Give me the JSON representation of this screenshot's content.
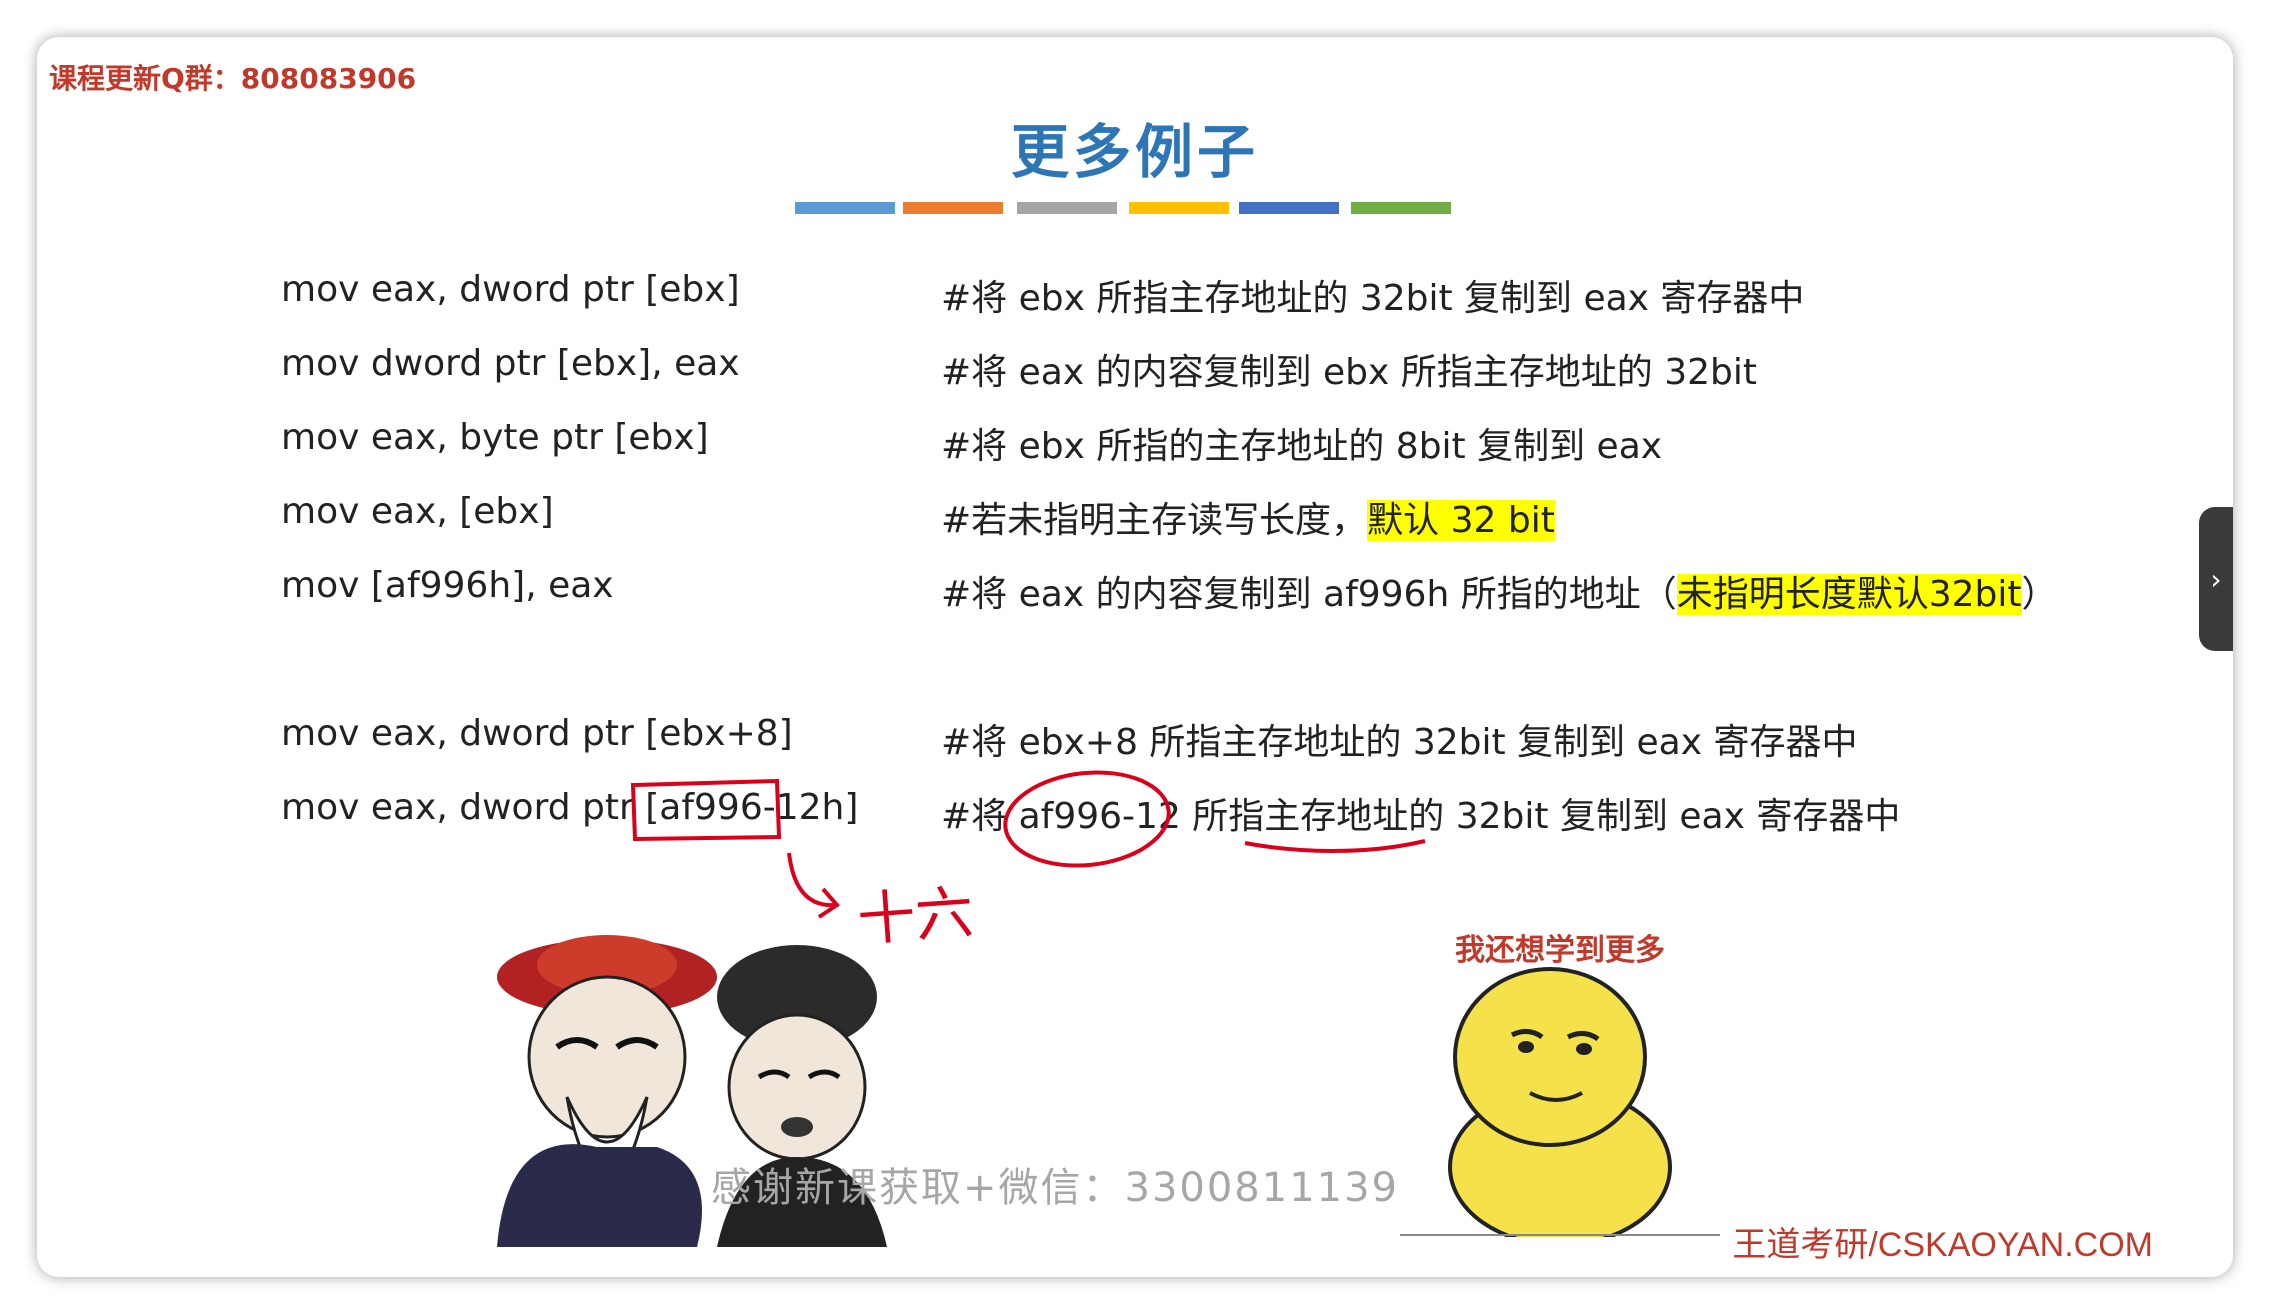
{
  "header": {
    "qq_note": "课程更新Q群：808083906"
  },
  "slide": {
    "title": "更多例子",
    "color_bar": [
      "#5b9bd5",
      "#ed7d31",
      "#a5a5a5",
      "#ffc000",
      "#4472c4",
      "#70ad47"
    ],
    "rows": [
      {
        "code": "mov eax, dword ptr [ebx]",
        "comment": "#将 ebx 所指主存地址的 32bit 复制到 eax 寄存器中"
      },
      {
        "code": "mov dword ptr [ebx], eax",
        "comment": "#将 eax 的内容复制到 ebx 所指主存地址的 32bit"
      },
      {
        "code": "mov eax, byte ptr [ebx]",
        "comment": "#将 ebx 所指的主存地址的 8bit 复制到 eax"
      },
      {
        "code": "mov eax, [ebx]",
        "comment_pre": "#若未指明主存读写长度，",
        "comment_hl": "默认 32 bit"
      },
      {
        "code": "mov [af996h], eax",
        "comment_pre": "#将 eax 的内容复制到 af996h 所指的地址（",
        "comment_hl": "未指明长度默认32bit",
        "comment_post": "）"
      },
      {
        "code": "mov eax, dword ptr [ebx+8]",
        "comment": "#将 ebx+8 所指主存地址的 32bit 复制到 eax 寄存器中"
      },
      {
        "code": "mov eax, dword ptr [af996-12h]",
        "comment": "#将 af996-12 所指主存地址的 32bit 复制到 eax 寄存器中"
      }
    ],
    "highlight_color": "#ffff00",
    "annotation": {
      "handwritten_note": "十六",
      "ink_color": "#d9001b"
    },
    "meme_right_caption": "我还想学到更多",
    "watermark": "感谢新课获取+微信：3300811139",
    "site": "王道考研/CSKAOYAN.COM"
  },
  "nav": {
    "next_icon": "chevron-right-icon"
  }
}
